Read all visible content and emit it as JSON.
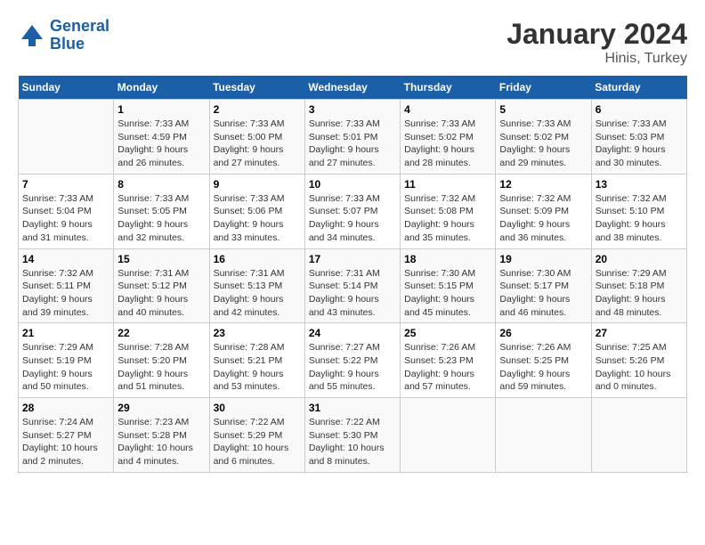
{
  "header": {
    "logo_line1": "General",
    "logo_line2": "Blue",
    "title": "January 2024",
    "subtitle": "Hinis, Turkey"
  },
  "columns": [
    "Sunday",
    "Monday",
    "Tuesday",
    "Wednesday",
    "Thursday",
    "Friday",
    "Saturday"
  ],
  "weeks": [
    [
      {
        "day": "",
        "info": ""
      },
      {
        "day": "1",
        "info": "Sunrise: 7:33 AM\nSunset: 4:59 PM\nDaylight: 9 hours\nand 26 minutes."
      },
      {
        "day": "2",
        "info": "Sunrise: 7:33 AM\nSunset: 5:00 PM\nDaylight: 9 hours\nand 27 minutes."
      },
      {
        "day": "3",
        "info": "Sunrise: 7:33 AM\nSunset: 5:01 PM\nDaylight: 9 hours\nand 27 minutes."
      },
      {
        "day": "4",
        "info": "Sunrise: 7:33 AM\nSunset: 5:02 PM\nDaylight: 9 hours\nand 28 minutes."
      },
      {
        "day": "5",
        "info": "Sunrise: 7:33 AM\nSunset: 5:02 PM\nDaylight: 9 hours\nand 29 minutes."
      },
      {
        "day": "6",
        "info": "Sunrise: 7:33 AM\nSunset: 5:03 PM\nDaylight: 9 hours\nand 30 minutes."
      }
    ],
    [
      {
        "day": "7",
        "info": "Sunrise: 7:33 AM\nSunset: 5:04 PM\nDaylight: 9 hours\nand 31 minutes."
      },
      {
        "day": "8",
        "info": "Sunrise: 7:33 AM\nSunset: 5:05 PM\nDaylight: 9 hours\nand 32 minutes."
      },
      {
        "day": "9",
        "info": "Sunrise: 7:33 AM\nSunset: 5:06 PM\nDaylight: 9 hours\nand 33 minutes."
      },
      {
        "day": "10",
        "info": "Sunrise: 7:33 AM\nSunset: 5:07 PM\nDaylight: 9 hours\nand 34 minutes."
      },
      {
        "day": "11",
        "info": "Sunrise: 7:32 AM\nSunset: 5:08 PM\nDaylight: 9 hours\nand 35 minutes."
      },
      {
        "day": "12",
        "info": "Sunrise: 7:32 AM\nSunset: 5:09 PM\nDaylight: 9 hours\nand 36 minutes."
      },
      {
        "day": "13",
        "info": "Sunrise: 7:32 AM\nSunset: 5:10 PM\nDaylight: 9 hours\nand 38 minutes."
      }
    ],
    [
      {
        "day": "14",
        "info": "Sunrise: 7:32 AM\nSunset: 5:11 PM\nDaylight: 9 hours\nand 39 minutes."
      },
      {
        "day": "15",
        "info": "Sunrise: 7:31 AM\nSunset: 5:12 PM\nDaylight: 9 hours\nand 40 minutes."
      },
      {
        "day": "16",
        "info": "Sunrise: 7:31 AM\nSunset: 5:13 PM\nDaylight: 9 hours\nand 42 minutes."
      },
      {
        "day": "17",
        "info": "Sunrise: 7:31 AM\nSunset: 5:14 PM\nDaylight: 9 hours\nand 43 minutes."
      },
      {
        "day": "18",
        "info": "Sunrise: 7:30 AM\nSunset: 5:15 PM\nDaylight: 9 hours\nand 45 minutes."
      },
      {
        "day": "19",
        "info": "Sunrise: 7:30 AM\nSunset: 5:17 PM\nDaylight: 9 hours\nand 46 minutes."
      },
      {
        "day": "20",
        "info": "Sunrise: 7:29 AM\nSunset: 5:18 PM\nDaylight: 9 hours\nand 48 minutes."
      }
    ],
    [
      {
        "day": "21",
        "info": "Sunrise: 7:29 AM\nSunset: 5:19 PM\nDaylight: 9 hours\nand 50 minutes."
      },
      {
        "day": "22",
        "info": "Sunrise: 7:28 AM\nSunset: 5:20 PM\nDaylight: 9 hours\nand 51 minutes."
      },
      {
        "day": "23",
        "info": "Sunrise: 7:28 AM\nSunset: 5:21 PM\nDaylight: 9 hours\nand 53 minutes."
      },
      {
        "day": "24",
        "info": "Sunrise: 7:27 AM\nSunset: 5:22 PM\nDaylight: 9 hours\nand 55 minutes."
      },
      {
        "day": "25",
        "info": "Sunrise: 7:26 AM\nSunset: 5:23 PM\nDaylight: 9 hours\nand 57 minutes."
      },
      {
        "day": "26",
        "info": "Sunrise: 7:26 AM\nSunset: 5:25 PM\nDaylight: 9 hours\nand 59 minutes."
      },
      {
        "day": "27",
        "info": "Sunrise: 7:25 AM\nSunset: 5:26 PM\nDaylight: 10 hours\nand 0 minutes."
      }
    ],
    [
      {
        "day": "28",
        "info": "Sunrise: 7:24 AM\nSunset: 5:27 PM\nDaylight: 10 hours\nand 2 minutes."
      },
      {
        "day": "29",
        "info": "Sunrise: 7:23 AM\nSunset: 5:28 PM\nDaylight: 10 hours\nand 4 minutes."
      },
      {
        "day": "30",
        "info": "Sunrise: 7:22 AM\nSunset: 5:29 PM\nDaylight: 10 hours\nand 6 minutes."
      },
      {
        "day": "31",
        "info": "Sunrise: 7:22 AM\nSunset: 5:30 PM\nDaylight: 10 hours\nand 8 minutes."
      },
      {
        "day": "",
        "info": ""
      },
      {
        "day": "",
        "info": ""
      },
      {
        "day": "",
        "info": ""
      }
    ]
  ]
}
